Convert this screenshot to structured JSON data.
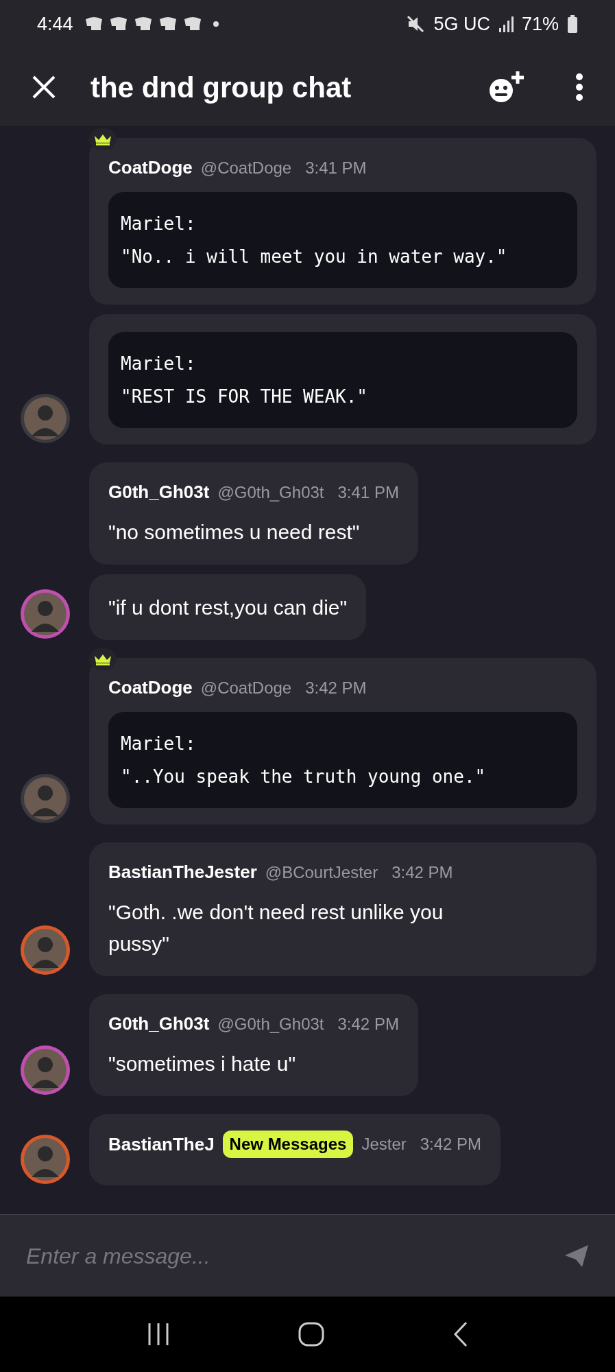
{
  "status_bar": {
    "time": "4:44",
    "network": "5G UC",
    "battery": "71%"
  },
  "header": {
    "title": "the dnd group chat"
  },
  "groups": [
    {
      "color": "#3a3a40",
      "messages": [
        {
          "author": "CoatDoge",
          "handle": "@CoatDoge",
          "time": "3:41 PM",
          "crown": true,
          "kind": "code",
          "lines": [
            "Mariel:",
            "\"No.. i will meet you in water way.\""
          ]
        },
        {
          "crown": false,
          "kind": "code",
          "lines": [
            "Mariel:",
            "\"REST IS FOR THE WEAK.\""
          ]
        }
      ]
    },
    {
      "color": "#c04fb0",
      "messages": [
        {
          "author": "G0th_Gh03t",
          "handle": "@G0th_Gh03t",
          "time": "3:41 PM",
          "crown": false,
          "kind": "text",
          "lines": [
            "\"no sometimes u need rest\""
          ]
        },
        {
          "crown": false,
          "kind": "text",
          "lines": [
            "\"if u dont rest,you can die\""
          ]
        }
      ]
    },
    {
      "color": "#3a3a40",
      "messages": [
        {
          "author": "CoatDoge",
          "handle": "@CoatDoge",
          "time": "3:42 PM",
          "crown": true,
          "kind": "code",
          "lines": [
            "Mariel:",
            "\"..You speak the truth young one.\""
          ]
        }
      ]
    },
    {
      "color": "#d9582a",
      "messages": [
        {
          "author": "BastianTheJester",
          "handle": "@BCourtJester",
          "time": "3:42 PM",
          "crown": false,
          "kind": "text",
          "lines": [
            "\"Goth. .we don't need rest unlike you pussy\""
          ]
        }
      ]
    },
    {
      "color": "#c04fb0",
      "messages": [
        {
          "author": "G0th_Gh03t",
          "handle": "@G0th_Gh03t",
          "time": "3:42 PM",
          "crown": false,
          "kind": "text",
          "lines": [
            "\"sometimes i hate u\""
          ]
        }
      ]
    },
    {
      "color": "#d9582a",
      "messages": [
        {
          "author": "BastianTheJ",
          "badge": "New Messages",
          "handle": "Jester",
          "time": "3:42 PM",
          "crown": false,
          "kind": "text"
        }
      ]
    }
  ],
  "composer": {
    "placeholder": "Enter a message..."
  }
}
